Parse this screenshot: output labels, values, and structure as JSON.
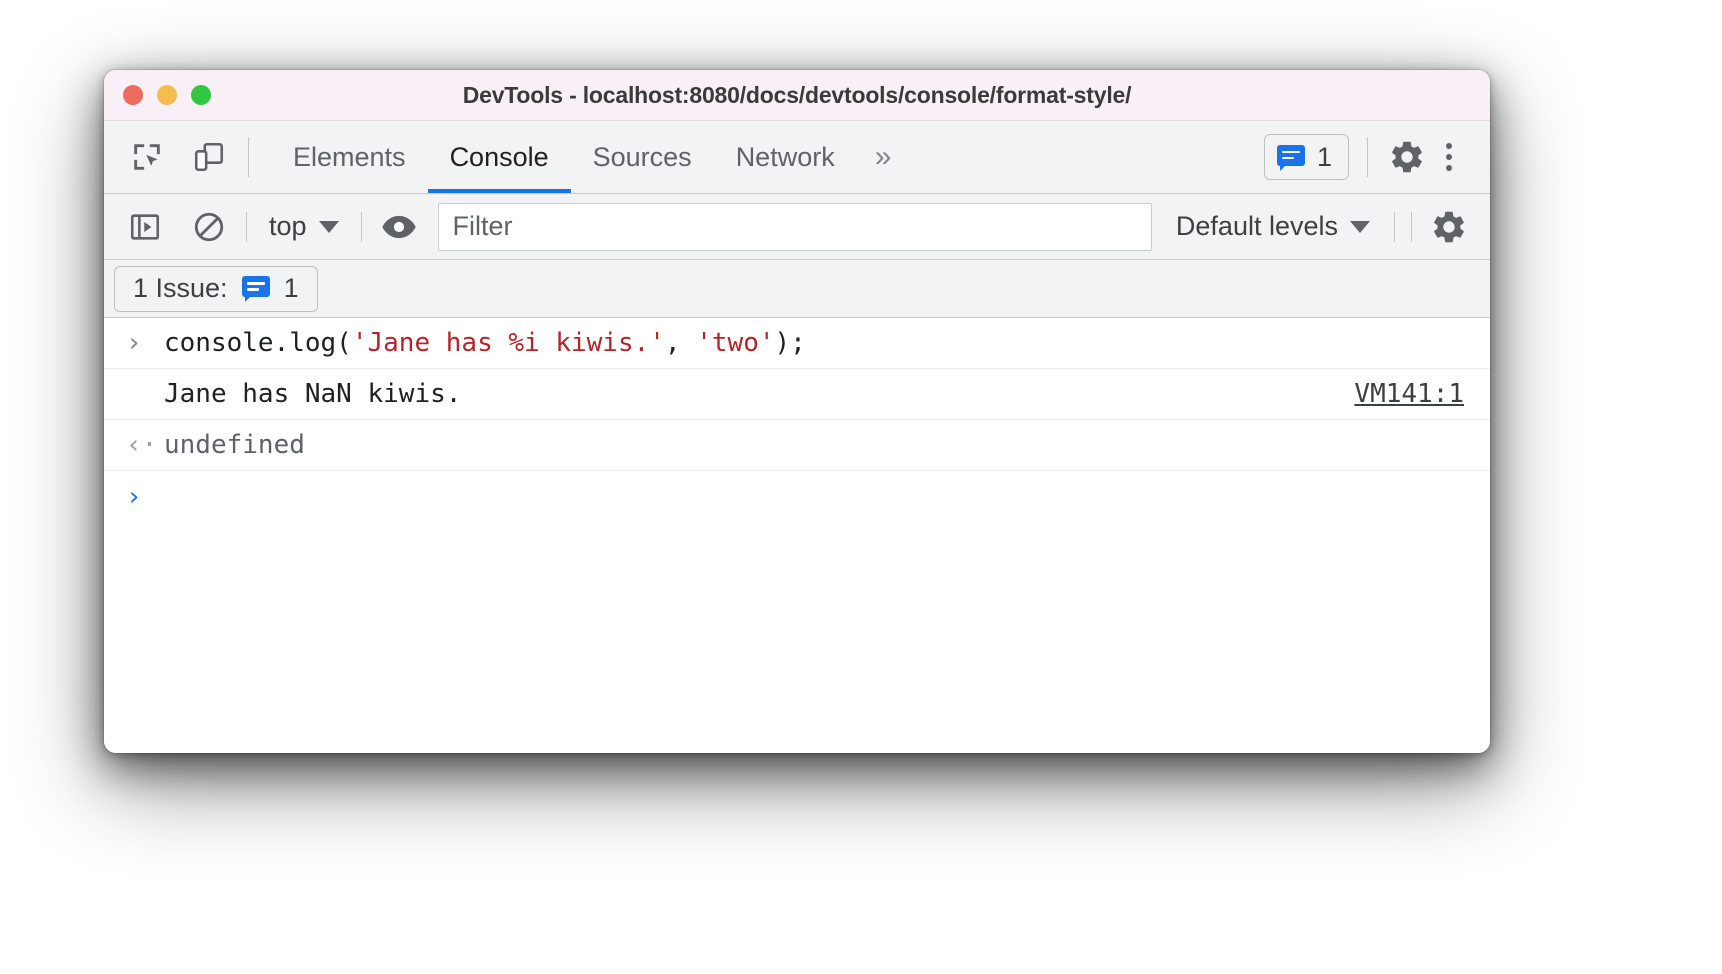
{
  "window": {
    "title": "DevTools - localhost:8080/docs/devtools/console/format-style/",
    "traffic_lights": [
      "close",
      "minimize",
      "maximize"
    ]
  },
  "tabbar": {
    "inspect_icon": "inspect-element-icon",
    "device_icon": "device-toolbar-icon",
    "tabs": [
      {
        "label": "Elements",
        "active": false
      },
      {
        "label": "Console",
        "active": true
      },
      {
        "label": "Sources",
        "active": false
      },
      {
        "label": "Network",
        "active": false
      }
    ],
    "more_tabs_label": "»",
    "issues_count": "1",
    "settings_icon": "gear-icon",
    "menu_icon": "kebab-menu-icon",
    "active_tab_underline_color": "#1a73e8"
  },
  "console_toolbar": {
    "sidebar_icon": "console-sidebar-icon",
    "clear_icon": "clear-console-icon",
    "context": "top",
    "eye_icon": "live-expression-eye-icon",
    "filter_placeholder": "Filter",
    "filter_value": "",
    "levels": "Default levels",
    "settings_icon": "console-settings-gear-icon"
  },
  "issues_bar": {
    "label": "1 Issue:",
    "count": "1",
    "badge_icon": "issues-bubble-icon",
    "badge_color": "#1a73e8"
  },
  "console": {
    "rows": [
      {
        "kind": "input",
        "marker": "›",
        "segments": [
          {
            "text": "console.log(",
            "style": "plain"
          },
          {
            "text": "'Jane has %i kiwis.'",
            "style": "string"
          },
          {
            "text": ", ",
            "style": "plain"
          },
          {
            "text": "'two'",
            "style": "string"
          },
          {
            "text": ");",
            "style": "plain"
          }
        ]
      },
      {
        "kind": "output",
        "marker": "",
        "text": "Jane has NaN kiwis.",
        "source_link": "VM141:1"
      },
      {
        "kind": "result",
        "marker": "‹·",
        "text": "undefined"
      }
    ],
    "prompt_marker": "›",
    "prompt_value": ""
  }
}
